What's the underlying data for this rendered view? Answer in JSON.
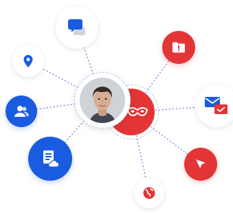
{
  "colors": {
    "blue": "#1a5ce0",
    "red": "#e33535",
    "link": "#5b78c7",
    "white": "#ffffff"
  },
  "nodes": [
    {
      "id": "chat",
      "icon": "chat-bubbles-icon"
    },
    {
      "id": "location",
      "icon": "map-pin-icon"
    },
    {
      "id": "contacts",
      "icon": "contacts-icon"
    },
    {
      "id": "document",
      "icon": "cloud-document-icon"
    },
    {
      "id": "alert",
      "icon": "alert-folder-icon"
    },
    {
      "id": "mail",
      "icon": "mail-check-icon"
    },
    {
      "id": "send",
      "icon": "cursor-arrow-icon"
    },
    {
      "id": "globe",
      "icon": "globe-icon"
    },
    {
      "id": "mask",
      "icon": "incognito-mask-icon"
    },
    {
      "id": "avatar",
      "icon": "user-avatar-photo"
    }
  ]
}
